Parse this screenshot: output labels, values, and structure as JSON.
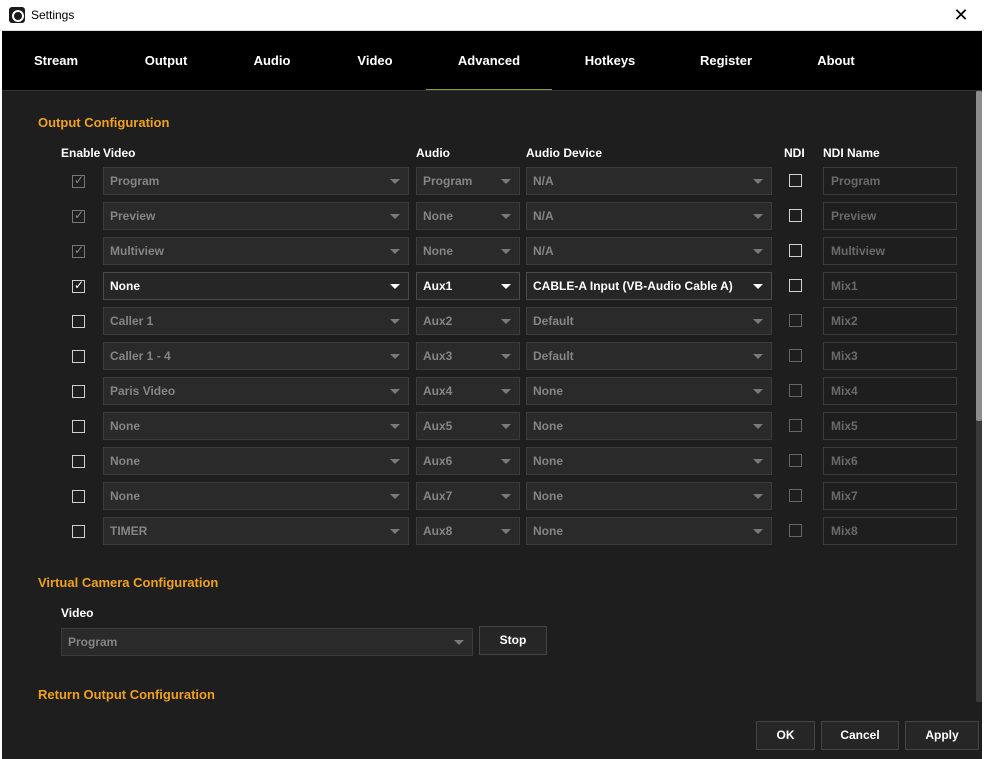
{
  "window": {
    "title": "Settings"
  },
  "tabs": [
    "Stream",
    "Output",
    "Audio",
    "Video",
    "Advanced",
    "Hotkeys",
    "Register",
    "About"
  ],
  "output_config": {
    "title": "Output Configuration",
    "headers": {
      "enable": "Enable",
      "video": "Video",
      "audio": "Audio",
      "audio_device": "Audio Device",
      "ndi": "NDI",
      "ndi_name": "NDI Name"
    },
    "rows": [
      {
        "enabled": true,
        "locked": true,
        "video": "Program",
        "audio": "Program",
        "device": "N/A",
        "ndi": false,
        "ndi_name": "Program",
        "active": false
      },
      {
        "enabled": true,
        "locked": true,
        "video": "Preview",
        "audio": "None",
        "device": "N/A",
        "ndi": false,
        "ndi_name": "Preview",
        "active": false
      },
      {
        "enabled": true,
        "locked": true,
        "video": "Multiview",
        "audio": "None",
        "device": "N/A",
        "ndi": false,
        "ndi_name": "Multiview",
        "active": false
      },
      {
        "enabled": true,
        "locked": false,
        "video": "None",
        "audio": "Aux1",
        "device": "CABLE-A Input (VB-Audio Cable A)",
        "ndi": false,
        "ndi_name": "Mix1",
        "active": true
      },
      {
        "enabled": false,
        "locked": false,
        "video": "Caller 1",
        "audio": "Aux2",
        "device": "Default",
        "ndi": false,
        "ndi_name": "Mix2",
        "active": false
      },
      {
        "enabled": false,
        "locked": false,
        "video": "Caller 1 - 4",
        "audio": "Aux3",
        "device": "Default",
        "ndi": false,
        "ndi_name": "Mix3",
        "active": false
      },
      {
        "enabled": false,
        "locked": false,
        "video": "Paris Video",
        "audio": "Aux4",
        "device": "None",
        "ndi": false,
        "ndi_name": "Mix4",
        "active": false
      },
      {
        "enabled": false,
        "locked": false,
        "video": "None",
        "audio": "Aux5",
        "device": "None",
        "ndi": false,
        "ndi_name": "Mix5",
        "active": false
      },
      {
        "enabled": false,
        "locked": false,
        "video": "None",
        "audio": "Aux6",
        "device": "None",
        "ndi": false,
        "ndi_name": "Mix6",
        "active": false
      },
      {
        "enabled": false,
        "locked": false,
        "video": "None",
        "audio": "Aux7",
        "device": "None",
        "ndi": false,
        "ndi_name": "Mix7",
        "active": false
      },
      {
        "enabled": false,
        "locked": false,
        "video": "TIMER",
        "audio": "Aux8",
        "device": "None",
        "ndi": false,
        "ndi_name": "Mix8",
        "active": false
      }
    ]
  },
  "virtual_camera": {
    "title": "Virtual Camera Configuration",
    "video_label": "Video",
    "video_value": "Program",
    "stop_label": "Stop"
  },
  "return_output": {
    "title": "Return Output Configuration"
  },
  "footer": {
    "ok": "OK",
    "cancel": "Cancel",
    "apply": "Apply"
  },
  "colors": {
    "accent": "#f0a020",
    "tab_bg": "#000000",
    "panel_bg": "#1e1e1e"
  },
  "icons": {
    "close": "close-icon",
    "checkbox": "check-icon",
    "dropdown": "chevron-down-icon",
    "app": "app-logo-icon"
  }
}
